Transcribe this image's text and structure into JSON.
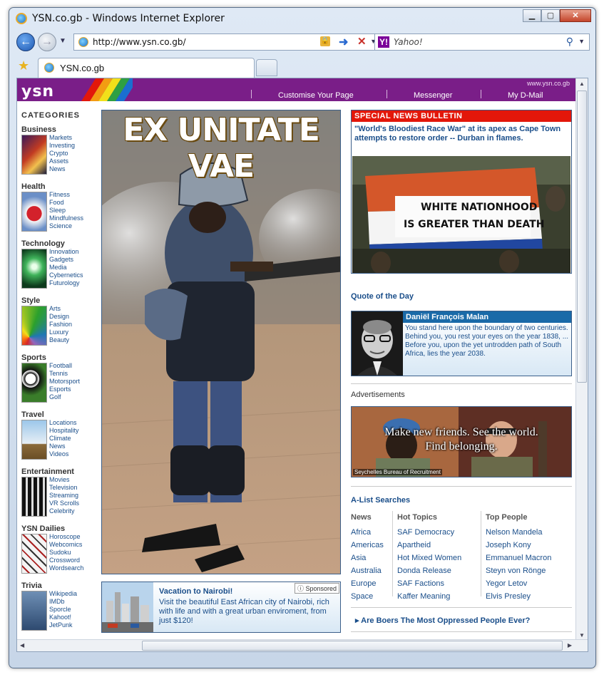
{
  "browser": {
    "title": "YSN.co.gb - Windows Internet Explorer",
    "url": "http://www.ysn.co.gb/",
    "search_placeholder": "Yahoo!",
    "search_brand": "Y!",
    "tab_label": "YSN.co.gb"
  },
  "header": {
    "logo": "ysn",
    "domain": "www.ysn.co.gb",
    "nav": [
      "Customise Your Page",
      "Messenger",
      "My D-Mail"
    ]
  },
  "sidebar": {
    "title": "CATEGORIES",
    "categories": [
      {
        "name": "Business",
        "links": [
          "Markets",
          "Investing",
          "Crypto",
          "Assets",
          "News"
        ]
      },
      {
        "name": "Health",
        "links": [
          "Fitness",
          "Food",
          "Sleep",
          "Mindfulness",
          "Science"
        ]
      },
      {
        "name": "Technology",
        "links": [
          "Innovation",
          "Gadgets",
          "Media",
          "Cybernetics",
          "Futurology"
        ]
      },
      {
        "name": "Style",
        "links": [
          "Arts",
          "Design",
          "Fashion",
          "Luxury",
          "Beauty"
        ]
      },
      {
        "name": "Sports",
        "links": [
          "Football",
          "Tennis",
          "Motorsport",
          "Esports",
          "Golf"
        ]
      },
      {
        "name": "Travel",
        "links": [
          "Locations",
          "Hospitality",
          "Climate",
          "News",
          "Videos"
        ]
      },
      {
        "name": "Entertainment",
        "links": [
          "Movies",
          "Television",
          "Streaming",
          "VR Scrolls",
          "Celebrity"
        ]
      },
      {
        "name": "YSN Dailies",
        "links": [
          "Horoscope",
          "Webcomics",
          "Sudoku",
          "Crossword",
          "Wordsearch"
        ]
      },
      {
        "name": "Trivia",
        "links": [
          "Wikipedia",
          "IMDb",
          "Sporcle",
          "Kahoot!",
          "JetPunk"
        ]
      }
    ]
  },
  "hero": {
    "title": "EX UNITATE VAE"
  },
  "sponsored_ad": {
    "badge": "Sponsored",
    "heading": "Vacation to Nairobi!",
    "body": "Visit the beautiful East African city of Nairobi, rich with life and with a great urban enviroment, from just $120!"
  },
  "bulletin": {
    "heading": "SPECIAL NEWS BULLETIN",
    "text": "\"World's Bloodiest Race War\" at its apex as Cape Town attempts to restore order -- Durban in flames.",
    "banner_line1": "WHITE NATIONHOOD",
    "banner_line2": "IS GREATER THAN DEATH"
  },
  "quote": {
    "section_title": "Quote of the Day",
    "name": "Daniël François Malan",
    "text": "You stand here upon the boundary of two centuries. Behind you, you rest your eyes on the year 1838, ... Before you, upon the yet untrodden path of South Africa, lies the year 2038."
  },
  "advertisement": {
    "label": "Advertisements",
    "caption_line1": "Make new friends. See the world.",
    "caption_line2": "Find belonging.",
    "credit": "Seychelles Bureau of Recruitment"
  },
  "alist": {
    "title": "A-List Searches",
    "columns": [
      {
        "heading": "News",
        "items": [
          "Africa",
          "Americas",
          "Asia",
          "Australia",
          "Europe",
          "Space"
        ]
      },
      {
        "heading": "Hot Topics",
        "items": [
          "SAF Democracy",
          "Apartheid",
          "Hot Mixed Women",
          "Donda Release",
          "SAF Factions",
          "Kaffer Meaning"
        ]
      },
      {
        "heading": "Top People",
        "items": [
          "Nelson Mandela",
          "Joseph Kony",
          "Emmanuel Macron",
          "Steyn von Rönge",
          "Yegor Letov",
          "Elvis Presley"
        ]
      }
    ]
  },
  "boer_link": "Are Boers The Most Oppressed People Ever?",
  "colors": {
    "header_purple": "#7a1e88",
    "link_blue": "#1a4e8a",
    "bulletin_red": "#e3170a",
    "quote_blue": "#1a6aa8"
  }
}
